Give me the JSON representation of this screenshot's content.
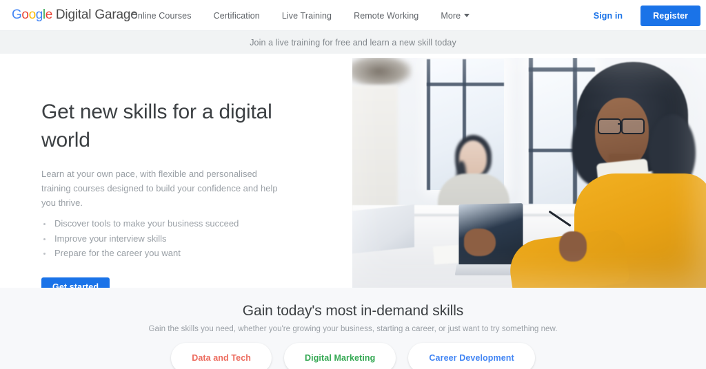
{
  "header": {
    "logo": {
      "google_letters": [
        {
          "char": "G",
          "color": "#4285F4"
        },
        {
          "char": "o",
          "color": "#EA4335"
        },
        {
          "char": "o",
          "color": "#FBBC05"
        },
        {
          "char": "g",
          "color": "#4285F4"
        },
        {
          "char": "l",
          "color": "#34A853"
        },
        {
          "char": "e",
          "color": "#EA4335"
        }
      ],
      "suffix": "Digital Garage"
    },
    "nav": [
      {
        "label": "Online Courses"
      },
      {
        "label": "Certification"
      },
      {
        "label": "Live Training"
      },
      {
        "label": "Remote Working"
      },
      {
        "label": "More"
      }
    ],
    "sign_in_label": "Sign in",
    "register_label": "Register"
  },
  "announcement": {
    "text": "Join a live training for free and learn a new skill today"
  },
  "hero": {
    "title": "Get new skills for a digital world",
    "subtitle": "Learn at your own pace, with flexible and personalised training courses designed to build your confidence and help you thrive.",
    "bullets": [
      "Discover tools to make your business succeed",
      "Improve your interview skills",
      "Prepare for the career you want"
    ],
    "cta_label": "Get started"
  },
  "skills": {
    "title": "Gain today's most in-demand skills",
    "subtitle": "Gain the skills you need, whether you're growing your business, starting a career, or just want to try something new.",
    "pills": [
      {
        "label": "Data and Tech",
        "color": "#EC6B5E"
      },
      {
        "label": "Digital Marketing",
        "color": "#34A853"
      },
      {
        "label": "Career Development",
        "color": "#4285F4"
      }
    ]
  },
  "colors": {
    "primary_blue": "#1A73E8",
    "band_gray": "#F1F3F4",
    "section_gray": "#F7F8FA",
    "text_dark": "#3C4043",
    "text_muted": "#9AA0A6"
  }
}
